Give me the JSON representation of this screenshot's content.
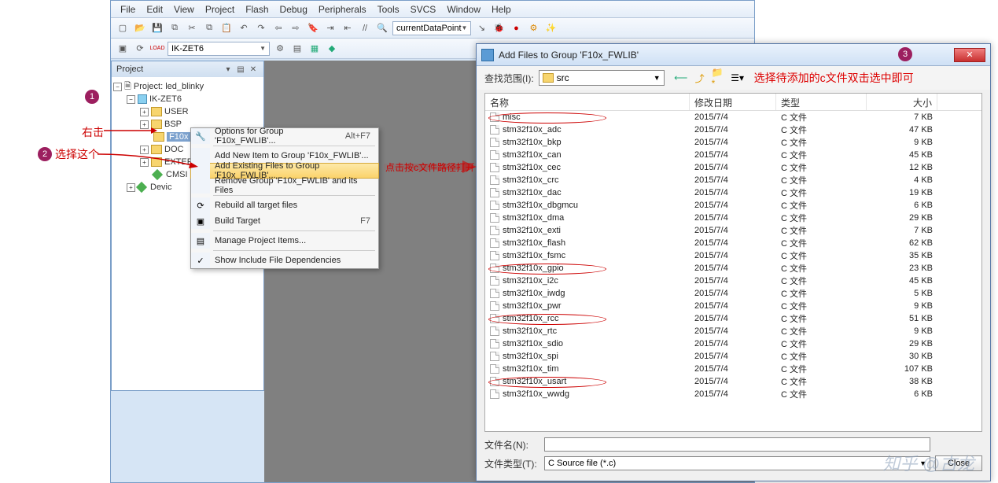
{
  "menubar": [
    "File",
    "Edit",
    "View",
    "Project",
    "Flash",
    "Debug",
    "Peripherals",
    "Tools",
    "SVCS",
    "Window",
    "Help"
  ],
  "toolbar_combo1": "currentDataPoint",
  "target_combo": "IK-ZET6",
  "project_panel": {
    "title": "Project",
    "root": "Project: led_blinky",
    "target": "IK-ZET6",
    "groups": [
      "USER",
      "BSP",
      "F10x",
      "DOC",
      "EXTER",
      "CMSI",
      "Devic"
    ]
  },
  "context_menu": {
    "items": [
      {
        "label": "Options for Group 'F10x_FWLIB'...",
        "shortcut": "Alt+F7",
        "icon": "wrench"
      },
      {
        "label": "Add New Item to Group 'F10x_FWLIB'...",
        "shortcut": "",
        "icon": ""
      },
      {
        "label": "Add Existing Files to Group 'F10x_FWLIB'...",
        "shortcut": "",
        "icon": "",
        "hl": true
      },
      {
        "label": "Remove Group 'F10x_FWLIB' and its Files",
        "shortcut": "",
        "icon": ""
      },
      {
        "label": "Rebuild all target files",
        "shortcut": "",
        "icon": "rebuild"
      },
      {
        "label": "Build Target",
        "shortcut": "F7",
        "icon": "build"
      },
      {
        "label": "Manage Project Items...",
        "shortcut": "",
        "icon": "manage"
      },
      {
        "label": "Show Include File Dependencies",
        "shortcut": "",
        "icon": "check"
      }
    ]
  },
  "dialog": {
    "title": "Add Files to Group 'F10x_FWLIB'",
    "lookin_label": "查找范围(I):",
    "lookin_value": "src",
    "red_note": "选择待添加的c文件双击选中即可",
    "headers": {
      "name": "名称",
      "date": "修改日期",
      "type": "类型",
      "size": "大小"
    },
    "files": [
      {
        "n": "misc",
        "d": "2015/7/4",
        "t": "C 文件",
        "s": "7 KB"
      },
      {
        "n": "stm32f10x_adc",
        "d": "2015/7/4",
        "t": "C 文件",
        "s": "47 KB"
      },
      {
        "n": "stm32f10x_bkp",
        "d": "2015/7/4",
        "t": "C 文件",
        "s": "9 KB"
      },
      {
        "n": "stm32f10x_can",
        "d": "2015/7/4",
        "t": "C 文件",
        "s": "45 KB"
      },
      {
        "n": "stm32f10x_cec",
        "d": "2015/7/4",
        "t": "C 文件",
        "s": "12 KB"
      },
      {
        "n": "stm32f10x_crc",
        "d": "2015/7/4",
        "t": "C 文件",
        "s": "4 KB"
      },
      {
        "n": "stm32f10x_dac",
        "d": "2015/7/4",
        "t": "C 文件",
        "s": "19 KB"
      },
      {
        "n": "stm32f10x_dbgmcu",
        "d": "2015/7/4",
        "t": "C 文件",
        "s": "6 KB"
      },
      {
        "n": "stm32f10x_dma",
        "d": "2015/7/4",
        "t": "C 文件",
        "s": "29 KB"
      },
      {
        "n": "stm32f10x_exti",
        "d": "2015/7/4",
        "t": "C 文件",
        "s": "7 KB"
      },
      {
        "n": "stm32f10x_flash",
        "d": "2015/7/4",
        "t": "C 文件",
        "s": "62 KB"
      },
      {
        "n": "stm32f10x_fsmc",
        "d": "2015/7/4",
        "t": "C 文件",
        "s": "35 KB"
      },
      {
        "n": "stm32f10x_gpio",
        "d": "2015/7/4",
        "t": "C 文件",
        "s": "23 KB"
      },
      {
        "n": "stm32f10x_i2c",
        "d": "2015/7/4",
        "t": "C 文件",
        "s": "45 KB"
      },
      {
        "n": "stm32f10x_iwdg",
        "d": "2015/7/4",
        "t": "C 文件",
        "s": "5 KB"
      },
      {
        "n": "stm32f10x_pwr",
        "d": "2015/7/4",
        "t": "C 文件",
        "s": "9 KB"
      },
      {
        "n": "stm32f10x_rcc",
        "d": "2015/7/4",
        "t": "C 文件",
        "s": "51 KB"
      },
      {
        "n": "stm32f10x_rtc",
        "d": "2015/7/4",
        "t": "C 文件",
        "s": "9 KB"
      },
      {
        "n": "stm32f10x_sdio",
        "d": "2015/7/4",
        "t": "C 文件",
        "s": "29 KB"
      },
      {
        "n": "stm32f10x_spi",
        "d": "2015/7/4",
        "t": "C 文件",
        "s": "30 KB"
      },
      {
        "n": "stm32f10x_tim",
        "d": "2015/7/4",
        "t": "C 文件",
        "s": "107 KB"
      },
      {
        "n": "stm32f10x_usart",
        "d": "2015/7/4",
        "t": "C 文件",
        "s": "38 KB"
      },
      {
        "n": "stm32f10x_wwdg",
        "d": "2015/7/4",
        "t": "C 文件",
        "s": "6 KB"
      }
    ],
    "filename_label": "文件名(N):",
    "filetype_label": "文件类型(T):",
    "filetype_value": "C Source file (*.c)",
    "close_btn": "Close"
  },
  "annotations": {
    "a1": "右击",
    "a2": "选择这个",
    "a3_note": "点击按c文件路径打开"
  },
  "watermark": "知乎 @古龙"
}
